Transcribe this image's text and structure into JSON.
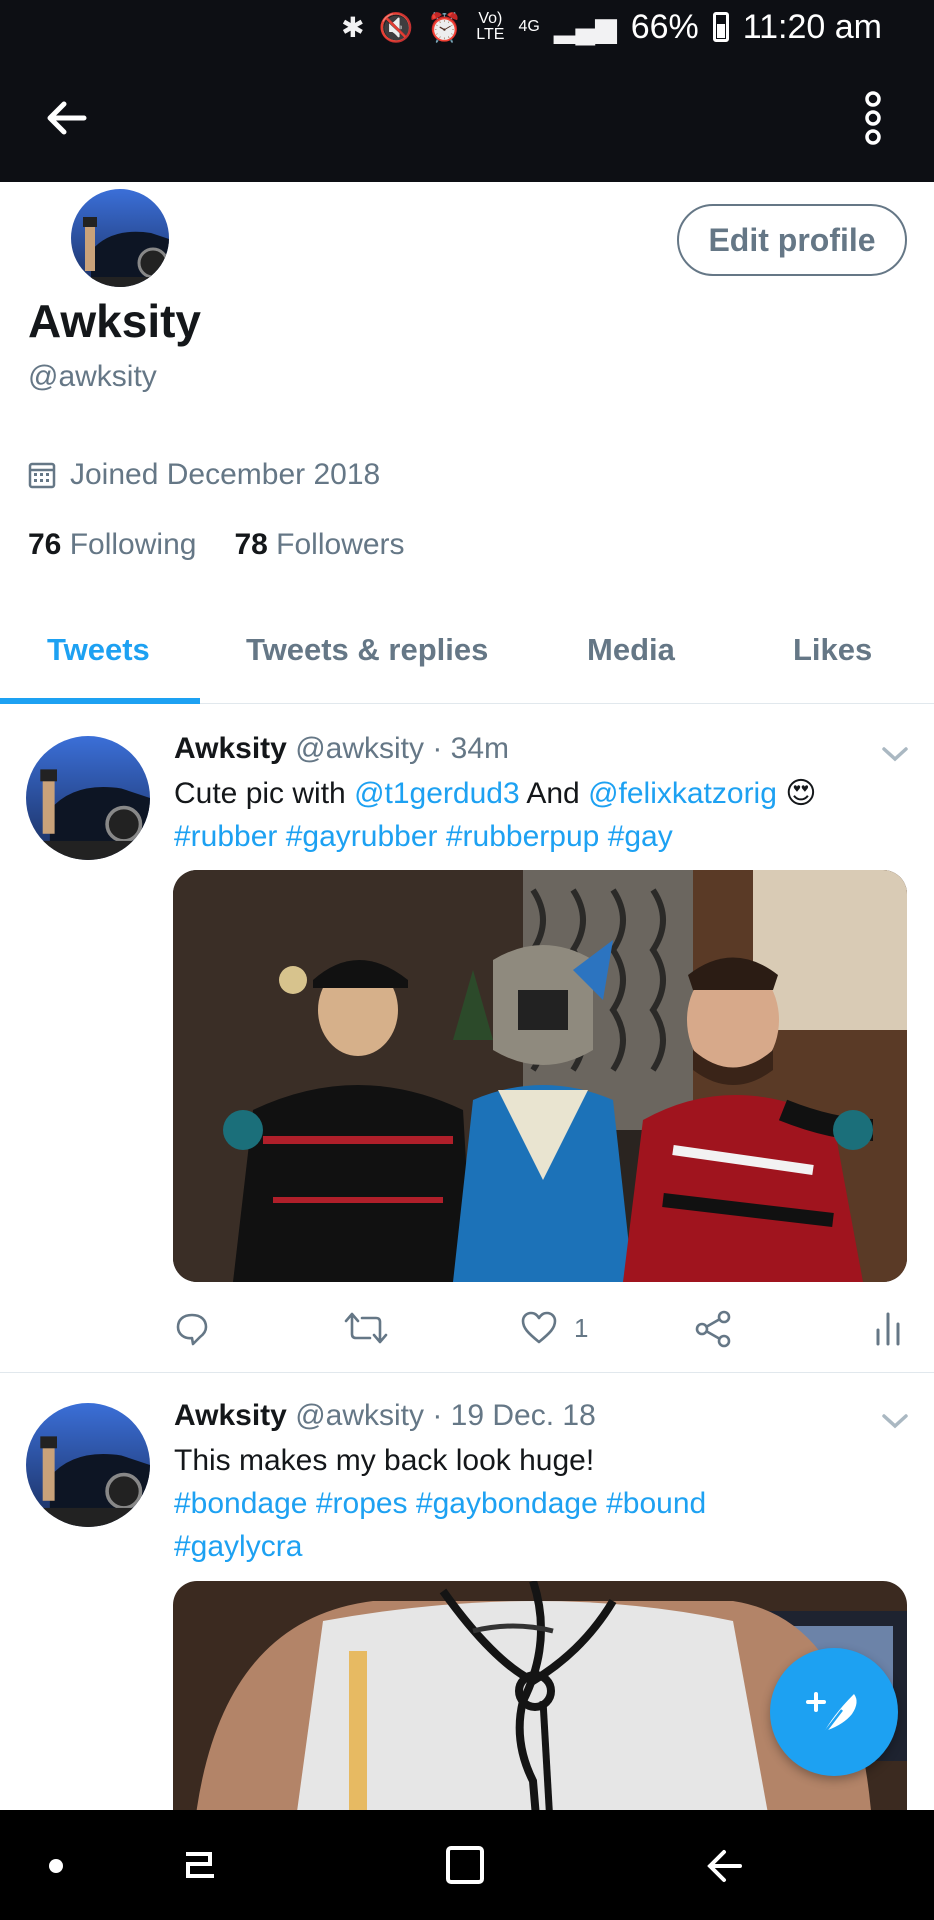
{
  "status_bar": {
    "bluetooth": "bluetooth-icon",
    "mute": "mute-icon",
    "alarm": "alarm-icon",
    "volte_top": "Vo)",
    "volte_bottom": "LTE",
    "network": "4G",
    "battery": "66%",
    "time": "11:20 am"
  },
  "header": {
    "back_icon": "back-arrow-icon",
    "more_icon": "more-vertical-icon"
  },
  "profile": {
    "name": "Awksity",
    "handle": "@awksity",
    "edit_label": "Edit profile",
    "joined": "Joined December 2018",
    "following_count": "76",
    "following_label": "Following",
    "followers_count": "78",
    "followers_label": "Followers"
  },
  "tabs": [
    {
      "label": "Tweets",
      "active": true
    },
    {
      "label": "Tweets & replies",
      "active": false
    },
    {
      "label": "Media",
      "active": false
    },
    {
      "label": "Likes",
      "active": false
    }
  ],
  "tweets": [
    {
      "name": "Awksity",
      "handle": "@awksity",
      "time": "· 34m",
      "text_parts": [
        "Cute pic with ",
        "@t1gerdud3",
        " And ",
        "@felixkatzorig",
        " 😍"
      ],
      "hashtags": [
        "#rubber",
        "#gayrubber",
        "#rubberpup",
        "#gay"
      ],
      "likes": "1"
    },
    {
      "name": "Awksity",
      "handle": "@awksity",
      "time": "· 19 Dec. 18",
      "text": "This makes my back look huge!",
      "hashtags_line1": [
        "#bondage",
        "#ropes",
        "#gaybondage",
        "#bound"
      ],
      "hashtags_line2": [
        "#gaylycra"
      ]
    }
  ],
  "colors": {
    "accent": "#1da1f2",
    "secondary_text": "#657786",
    "header_bg": "#0d0f14"
  }
}
